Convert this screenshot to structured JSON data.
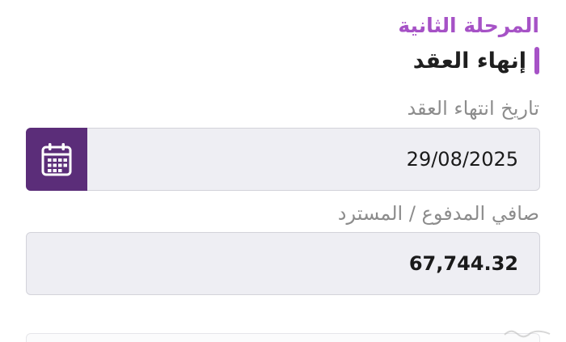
{
  "stage": {
    "label": "المرحلة الثانية",
    "color": "#a652c6"
  },
  "section": {
    "title": "إنهاء العقد"
  },
  "contract_end_date": {
    "label": "تاريخ انتهاء العقد",
    "value": "29/08/2025",
    "icon": "calendar-icon",
    "button_color": "#5b2d79"
  },
  "net_amount": {
    "label": "صافي المدفوع / المسترد",
    "value": "67,744.32"
  },
  "colors": {
    "accent": "#a652c6",
    "field_background": "#eeeef3",
    "label_text": "#8c8c8c"
  }
}
